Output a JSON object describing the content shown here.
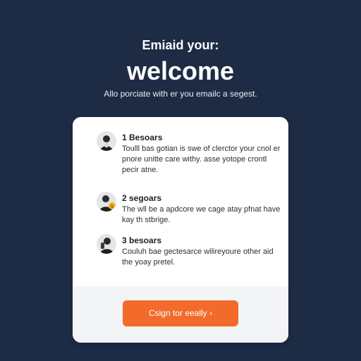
{
  "hero": {
    "eyebrow": "Emiaid your:",
    "title": "welcome",
    "subtitle": "Allo porciate with er you emailc a segest."
  },
  "steps": [
    {
      "title": "1 Besoars",
      "description": "Toulll bas gotian is swe of clerctor your cnol er pnore unitte care withy. asse yotope crontl pecir atne.",
      "avatar_icon": "person-avatar-icon"
    },
    {
      "title": "2 segoars",
      "description": "The wll be a apdcore we cage atay pfnat have kay th stbrige.",
      "avatar_icon": "person-with-coin-avatar-icon"
    },
    {
      "title": "3 besoars",
      "description": "Couluh bae gectesarce wilireyoure other aid the yoay pretel.",
      "avatar_icon": "thinking-person-avatar-icon"
    }
  ],
  "cta": {
    "label": "Csign tor eeally ›"
  },
  "colors": {
    "background": "#1d2b45",
    "card": "#ffffff",
    "footer": "#f3f4f6",
    "accent": "#f26b2a"
  }
}
